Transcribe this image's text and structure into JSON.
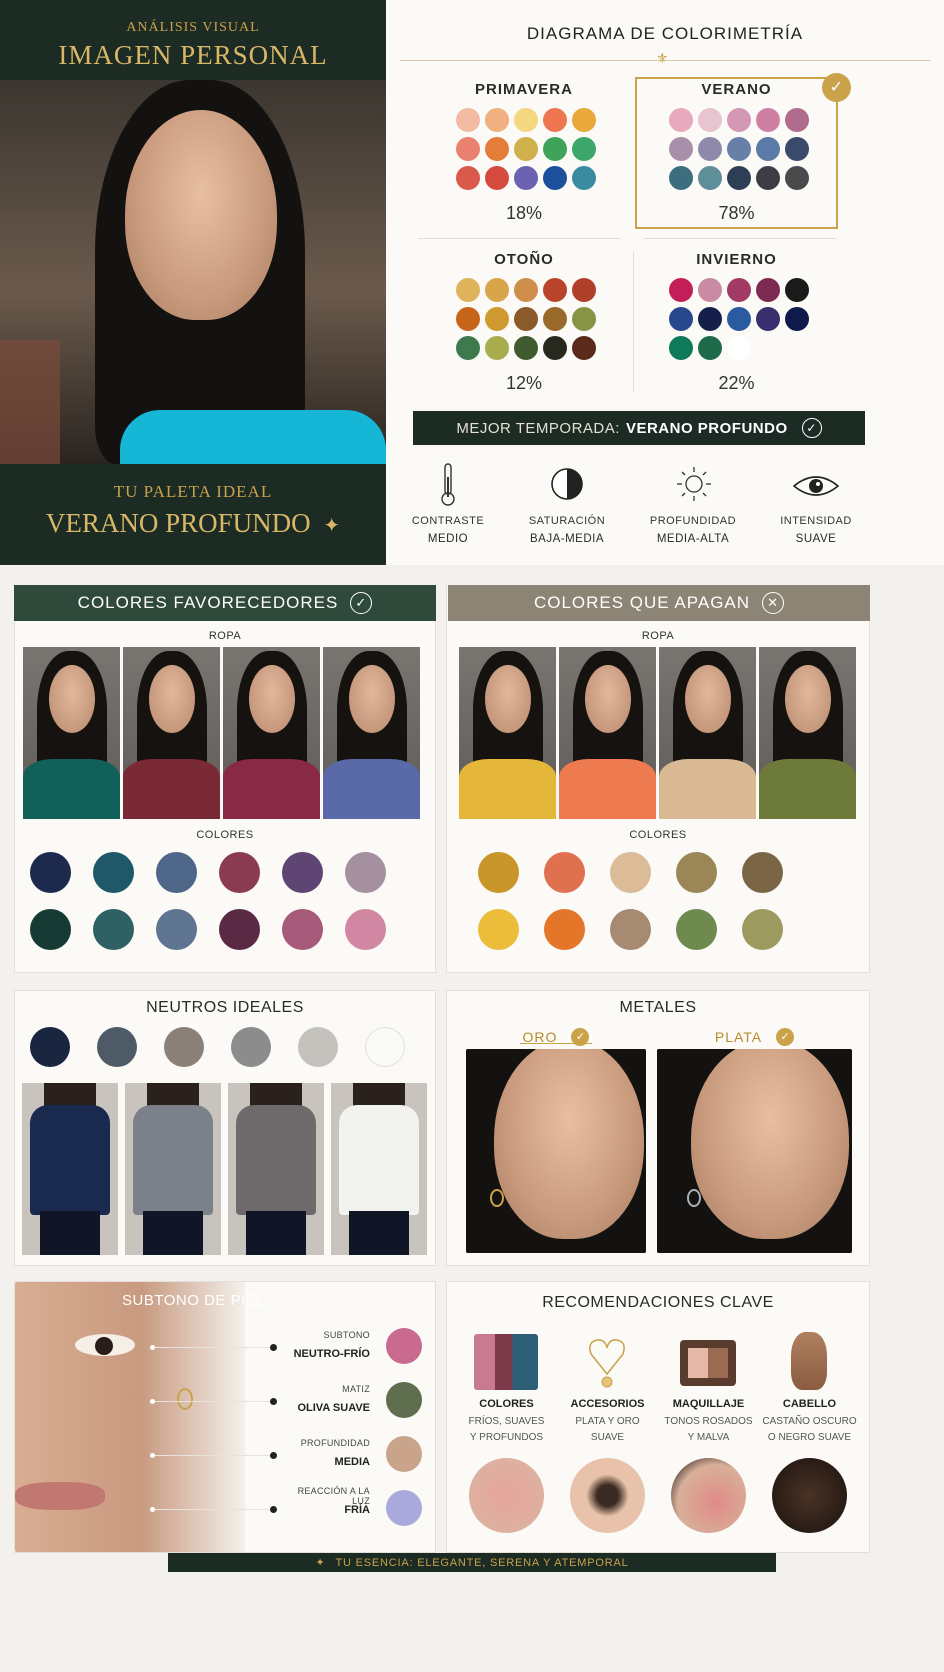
{
  "hero": {
    "eyebrow": "ANÁLISIS VISUAL",
    "title": "IMAGEN PERSONAL",
    "palette_label": "TU PALETA IDEAL",
    "palette_name": "VERANO PROFUNDO"
  },
  "diagram": {
    "title": "DIAGRAMA DE COLORIMETRÍA",
    "seasons": [
      {
        "name": "PRIMAVERA",
        "pct": "18%",
        "colors": [
          "#f3bca2",
          "#f0b080",
          "#f5d77f",
          "#ee7550",
          "#e8a83a",
          "#ea8070",
          "#e47c3a",
          "#cfb04a",
          "#3fa35a",
          "#3da66a",
          "#d95a4a",
          "#d44a3e",
          "#6b63b0",
          "#1c4f9c",
          "#3a8aa0"
        ]
      },
      {
        "name": "VERANO",
        "pct": "78%",
        "colors": [
          "#e8a9bf",
          "#e7c4d0",
          "#d498b4",
          "#cf7fa2",
          "#b06c8c",
          "#a890ab",
          "#8f8aab",
          "#6680a8",
          "#5c7aa6",
          "#3a4a6a",
          "#3c6e7f",
          "#5e8e98",
          "#2e3f55",
          "#3d3d44",
          "#4a4a4d"
        ]
      },
      {
        "name": "OTOÑO",
        "pct": "12%",
        "colors": [
          "#dfb35a",
          "#d8a54a",
          "#cf8f4a",
          "#b9442a",
          "#b0402a",
          "#c6651a",
          "#cf9a2f",
          "#8a5a2a",
          "#9a6a2a",
          "#889445",
          "#3e7a4e",
          "#a7ad4a",
          "#3e5a2e",
          "#27281e",
          "#5a2a1a"
        ]
      },
      {
        "name": "INVIERNO",
        "pct": "22%",
        "colors": [
          "#c41e58",
          "#c98aa4",
          "#a23a66",
          "#7c2a52",
          "#1a1a1a",
          "#27488d",
          "#15204a",
          "#2a5aa0",
          "#3a2f6e",
          "#0e1a4a",
          "#0e7a5a",
          "#1e6a4a",
          "#ffffff"
        ]
      }
    ],
    "best_label": "MEJOR TEMPORADA:",
    "best_value": "VERANO PROFUNDO",
    "attributes": [
      {
        "icon": "thermometer-icon",
        "label": "CONTRASTE",
        "value": "MEDIO"
      },
      {
        "icon": "half-circle-icon",
        "label": "SATURACIÓN",
        "value": "BAJA-MEDIA"
      },
      {
        "icon": "sun-icon",
        "label": "PROFUNDIDAD",
        "value": "MEDIA-ALTA"
      },
      {
        "icon": "eye-icon",
        "label": "INTENSIDAD",
        "value": "SUAVE"
      }
    ]
  },
  "favor": {
    "title": "COLORES FAVORECEDORES",
    "ropa": "ROPA",
    "colores": "COLORES",
    "drapes": [
      "#12605a",
      "#7a2a35",
      "#8a2848",
      "#5a6aa8"
    ],
    "swatches": [
      "#1d2a4e",
      "#1f5868",
      "#4e6688",
      "#8a3a52",
      "#5e4574",
      "#a5909f",
      "#163b34",
      "#2e6064",
      "#5e7490",
      "#5a2a44",
      "#a45a78",
      "#d187a2"
    ]
  },
  "dull": {
    "title": "COLORES QUE APAGAN",
    "ropa": "ROPA",
    "colores": "COLORES",
    "drapes": [
      "#e4b63a",
      "#ee7a50",
      "#d9b894",
      "#6e7a3a"
    ],
    "swatches": [
      "#c8962a",
      "#df7050",
      "#dcbb98",
      "#9a8656",
      "#7a6644",
      "#ebbd3a",
      "#e4762a",
      "#a68a72",
      "#6e8a4e",
      "#9c9a5e"
    ]
  },
  "neutrals": {
    "title": "NEUTROS IDEALES",
    "swatches": [
      "#1a2540",
      "#4e5a66",
      "#8a8078",
      "#8c8c8c",
      "#c4c2bd",
      "#fafaf8"
    ],
    "outfits": [
      "#1a2a4e",
      "#7c8088",
      "#6e6a6c",
      "#f2f2ef"
    ]
  },
  "metals": {
    "title": "METALES",
    "items": [
      {
        "name": "ORO"
      },
      {
        "name": "PLATA"
      }
    ]
  },
  "skin": {
    "title": "SUBTONO DE PIEL",
    "rows": [
      {
        "label": "SUBTONO",
        "value": "NEUTRO-FRÍO",
        "color": "#c96a8e"
      },
      {
        "label": "MATIZ",
        "value": "OLIVA SUAVE",
        "color": "#5e6e4e"
      },
      {
        "label": "PROFUNDIDAD",
        "value": "MEDIA",
        "color": "#c9a48a"
      },
      {
        "label": "REACCIÓN A LA LUZ",
        "value": "FRÍA",
        "color": "#a9a9dd"
      }
    ]
  },
  "recs": {
    "title": "RECOMENDACIONES CLAVE",
    "items": [
      {
        "title": "COLORES",
        "line1": "FRÍOS, SUAVES",
        "line2": "Y PROFUNDOS"
      },
      {
        "title": "ACCESORIOS",
        "line1": "PLATA Y ORO",
        "line2": "SUAVE"
      },
      {
        "title": "MAQUILLAJE",
        "line1": "TONOS ROSADOS",
        "line2": "Y MALVA"
      },
      {
        "title": "CABELLO",
        "line1": "CASTAÑO OSCURO",
        "line2": "O NEGRO SUAVE"
      }
    ]
  },
  "footer": {
    "text": "TU ESENCIA: ELEGANTE, SERENA Y ATEMPORAL"
  },
  "accent": {
    "gold": "#c9a24a",
    "dark_green": "#1c2b23",
    "header_green": "#2f4a3a",
    "taupe": "#8c8474"
  }
}
